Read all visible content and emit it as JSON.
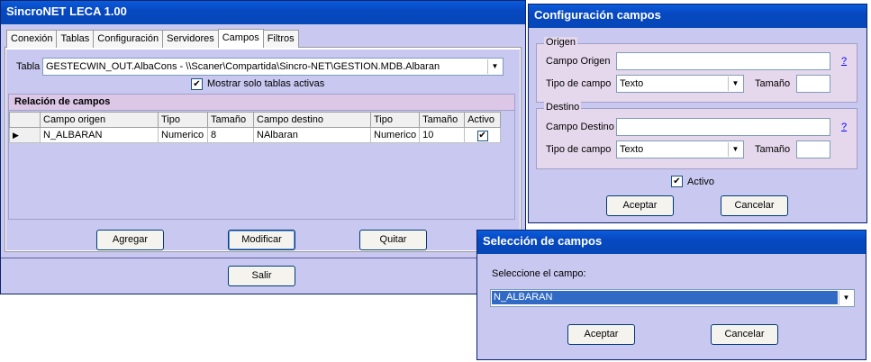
{
  "main": {
    "title": "SincroNET LECA 1.00",
    "tabs": [
      {
        "label": "Conexión"
      },
      {
        "label": "Tablas"
      },
      {
        "label": "Configuración"
      },
      {
        "label": "Servidores"
      },
      {
        "label": "Campos"
      },
      {
        "label": "Filtros"
      }
    ],
    "tabla_label": "Tabla",
    "tabla_value": "GESTECWIN_OUT.AlbaCons - \\\\Scaner\\Compartida\\Sincro-NET\\GESTION.MDB.Albaran",
    "mostrar_label": "Mostrar solo tablas activas",
    "mostrar_checked": true,
    "relacion_title": "Relación de campos",
    "columns": [
      "Campo origen",
      "Tipo",
      "Tamaño",
      "Campo destino",
      "Tipo",
      "Tamaño",
      "Activo"
    ],
    "rows": [
      {
        "indicator": "▶",
        "origen": "N_ALBARAN",
        "tipo_o": "Numerico",
        "tam_o": "8",
        "destino": "NAlbaran",
        "tipo_d": "Numerico",
        "tam_d": "10",
        "activo": true
      }
    ],
    "agregar": "Agregar",
    "modificar": "Modificar",
    "quitar": "Quitar",
    "salir": "Salir"
  },
  "config": {
    "title": "Configuración campos",
    "origen_group": "Origen",
    "campo_origen_label": "Campo Origen",
    "campo_origen_value": "",
    "tipo_label": "Tipo de campo",
    "tipo_origen_value": "Texto",
    "tamano_label": "Tamaño",
    "help": "?",
    "destino_group": "Destino",
    "campo_destino_label": "Campo Destino",
    "campo_destino_value": "",
    "tipo_destino_value": "Texto",
    "activo_label": "Activo",
    "activo_checked": true,
    "aceptar": "Aceptar",
    "cancelar": "Cancelar"
  },
  "seleccion": {
    "title": "Selección de campos",
    "prompt": "Seleccione el campo:",
    "selected": "N_ALBARAN",
    "aceptar": "Aceptar",
    "cancelar": "Cancelar"
  }
}
